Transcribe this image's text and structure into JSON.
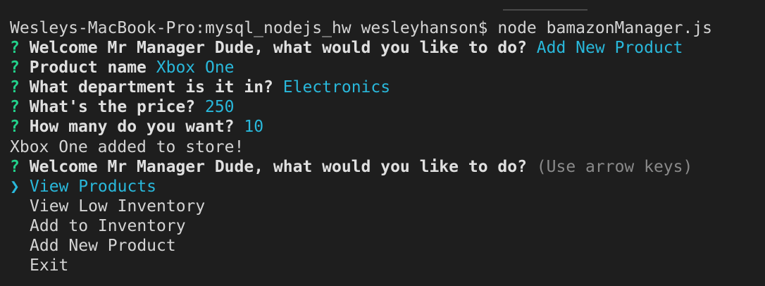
{
  "prompt": {
    "host": "Wesleys-MacBook-Pro:mysql_nodejs_hw wesleyhanson$",
    "command": "node bamazonManager.js"
  },
  "question_mark": "?",
  "qa": [
    {
      "question": "Welcome Mr Manager Dude, what would you like to do?",
      "answer": "Add New Product"
    },
    {
      "question": "Product name",
      "answer": "Xbox One"
    },
    {
      "question": "What department is it in?",
      "answer": "Electronics"
    },
    {
      "question": "What's the price?",
      "answer": "250"
    },
    {
      "question": "How many do you want?",
      "answer": "10"
    }
  ],
  "result": "Xbox One added to store!",
  "menu": {
    "question": "Welcome Mr Manager Dude, what would you like to do?",
    "hint": "(Use arrow keys)",
    "pointer": "❯",
    "options": [
      "View Products",
      "View Low Inventory",
      "Add to Inventory",
      "Add New Product",
      "Exit"
    ]
  },
  "colors": {
    "background": "#1e1e1e",
    "answer": "#29b8db",
    "question_mark": "#23d18b",
    "hint": "#8a8a8a"
  }
}
